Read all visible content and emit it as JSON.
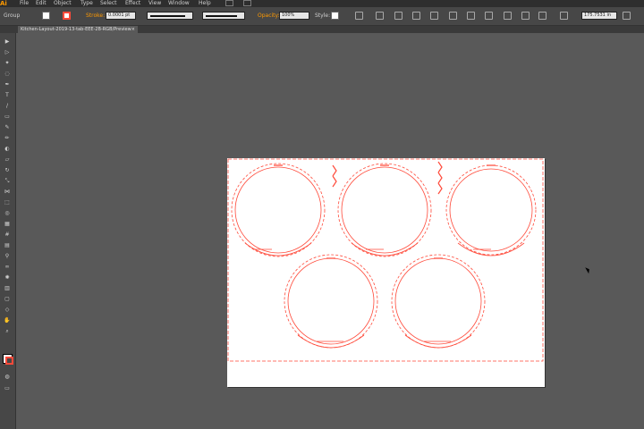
{
  "app": {
    "logo": "Ai"
  },
  "menubar": {
    "items": [
      "File",
      "Edit",
      "Object",
      "Type",
      "Select",
      "Effect",
      "View",
      "Window",
      "Help"
    ]
  },
  "control": {
    "selection_label": "Group",
    "stroke_label": "Stroke:",
    "stroke_weight": "0.0001 pt",
    "brush": "Uniform",
    "profile": "Basic",
    "opacity_label": "Opacity:",
    "opacity": "100%",
    "style_label": "Style:",
    "width": "175.7531 in"
  },
  "document": {
    "tab_title": "Kitchen-Layout-2019-13-tab-EEE-2B-RGB/Preview",
    "close": "×"
  },
  "colors": {
    "stroke": "#ff4a3a",
    "canvas": "#595959",
    "accent": "#ff9a00"
  }
}
